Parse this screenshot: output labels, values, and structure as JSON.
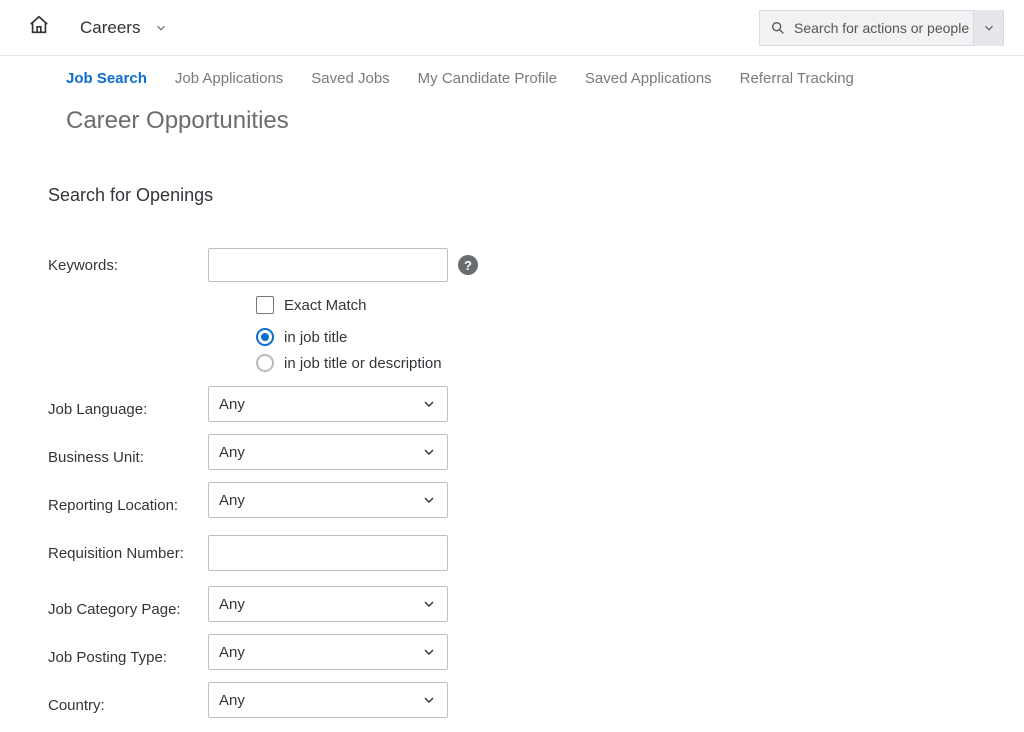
{
  "header": {
    "brand": "Careers",
    "search_placeholder": "Search for actions or people"
  },
  "tabs": [
    {
      "label": "Job Search",
      "active": true
    },
    {
      "label": "Job Applications"
    },
    {
      "label": "Saved Jobs"
    },
    {
      "label": "My Candidate Profile"
    },
    {
      "label": "Saved Applications"
    },
    {
      "label": "Referral Tracking"
    }
  ],
  "page_title": "Career Opportunities",
  "section_title": "Search for Openings",
  "form": {
    "keywords_label": "Keywords:",
    "exact_match_label": "Exact Match",
    "radio1": "in job title",
    "radio2": "in job title or description",
    "fields": [
      {
        "label": "Job Language:",
        "value": "Any",
        "type": "select"
      },
      {
        "label": "Business Unit:",
        "value": "Any",
        "type": "select"
      },
      {
        "label": "Reporting Location:",
        "value": "Any",
        "type": "select"
      },
      {
        "label": "Requisition Number:",
        "value": "",
        "type": "text"
      },
      {
        "label": "Job Category Page:",
        "value": "Any",
        "type": "select"
      },
      {
        "label": "Job Posting Type:",
        "value": "Any",
        "type": "select"
      },
      {
        "label": "Country:",
        "value": "Any",
        "type": "select"
      }
    ]
  }
}
